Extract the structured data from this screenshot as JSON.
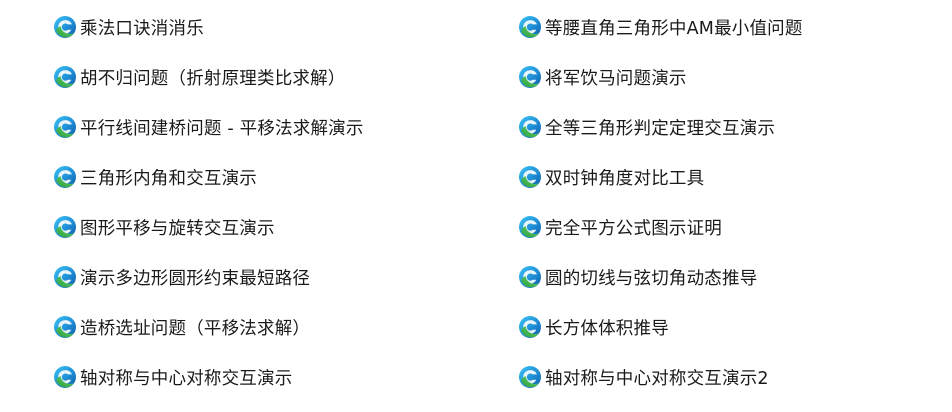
{
  "files": {
    "left": [
      {
        "label": "乘法口诀消消乐",
        "icon": "edge-html-file-icon"
      },
      {
        "label": "胡不归问题（折射原理类比求解）",
        "icon": "edge-html-file-icon"
      },
      {
        "label": "平行线间建桥问题 - 平移法求解演示",
        "icon": "edge-html-file-icon"
      },
      {
        "label": "三角形内角和交互演示",
        "icon": "edge-html-file-icon"
      },
      {
        "label": "图形平移与旋转交互演示",
        "icon": "edge-html-file-icon"
      },
      {
        "label": "演示多边形圆形约束最短路径",
        "icon": "edge-html-file-icon"
      },
      {
        "label": "造桥选址问题（平移法求解）",
        "icon": "edge-html-file-icon"
      },
      {
        "label": "轴对称与中心对称交互演示",
        "icon": "edge-html-file-icon"
      }
    ],
    "right": [
      {
        "label": "等腰直角三角形中AM最小值问题",
        "icon": "edge-html-file-icon"
      },
      {
        "label": "将军饮马问题演示",
        "icon": "edge-html-file-icon"
      },
      {
        "label": "全等三角形判定定理交互演示",
        "icon": "edge-html-file-icon"
      },
      {
        "label": "双时钟角度对比工具",
        "icon": "edge-html-file-icon"
      },
      {
        "label": "完全平方公式图示证明",
        "icon": "edge-html-file-icon"
      },
      {
        "label": "圆的切线与弦切角动态推导",
        "icon": "edge-html-file-icon"
      },
      {
        "label": "长方体体积推导",
        "icon": "edge-html-file-icon"
      },
      {
        "label": "轴对称与中心对称交互演示2",
        "icon": "edge-html-file-icon"
      }
    ]
  }
}
